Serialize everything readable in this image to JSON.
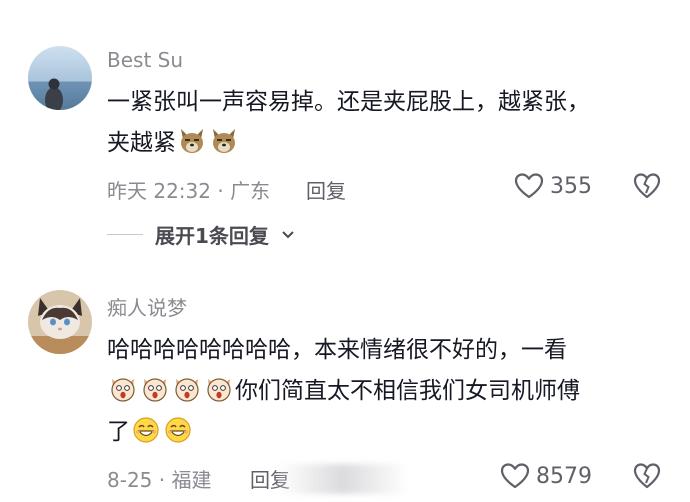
{
  "comments": [
    {
      "author": "Best Su",
      "lines": [
        "一紧张叫一声容易掉。还是夹屁股上，越紧张，",
        "夹越紧"
      ],
      "line2_emojis": [
        "wolf-emoji",
        "wolf-emoji"
      ],
      "meta": "昨天 22:32 · 广东",
      "reply_label": "回复",
      "like_count": "355",
      "expand_label": "展开1条回复"
    },
    {
      "author": "痴人说梦",
      "lines": [
        "哈哈哈哈哈哈哈哈，本来情绪很不好的，一看",
        "你们简直太不相信我们女司机师傅",
        "了"
      ],
      "line2_emojis": [
        "shocked-emoji",
        "shocked-emoji",
        "shocked-emoji",
        "shocked-emoji"
      ],
      "line3_emojis": [
        "grin-emoji",
        "grin-emoji"
      ],
      "meta": "8-25 · 福建",
      "reply_label": "回复",
      "like_count": "8579"
    }
  ],
  "colors": {
    "text": "#161823",
    "secondary": "#8a8b91",
    "icon": "#5f6068"
  }
}
